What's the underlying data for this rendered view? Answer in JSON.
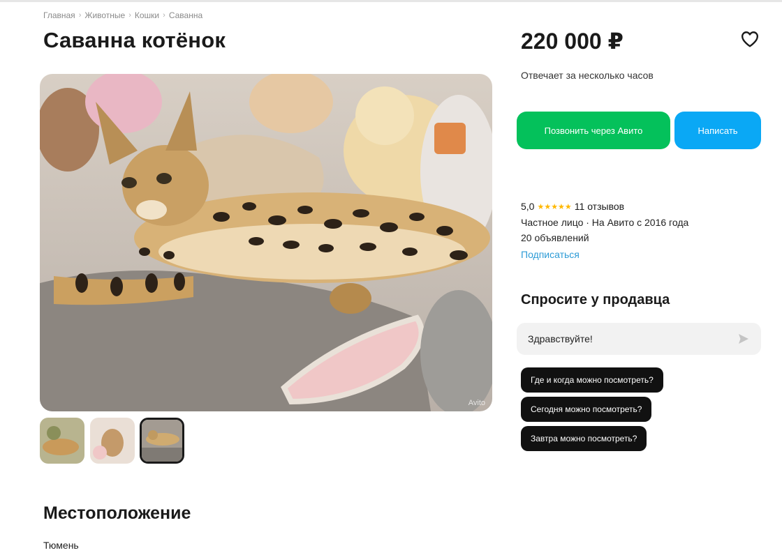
{
  "breadcrumb": [
    "Главная",
    "Животные",
    "Кошки",
    "Саванна"
  ],
  "listing": {
    "title": "Саванна котёнок",
    "price": "220 000 ₽"
  },
  "seller": {
    "reply_time": "Отвечает за несколько часов",
    "rating": "5,0",
    "stars": "★★★★★",
    "reviews": "11 отзывов",
    "type": "Частное лицо · На Авито с 2016 года",
    "ads_count": "20 объявлений",
    "subscribe_label": "Подписаться"
  },
  "actions": {
    "call_label": "Позвонить через Авито",
    "write_label": "Написать"
  },
  "ask": {
    "title": "Спросите у продавца",
    "message_value": "Здравствуйте!",
    "quick_questions": [
      "Где и когда можно посмотреть?",
      "Сегодня можно посмотреть?",
      "Завтра можно посмотреть?"
    ]
  },
  "photo": {
    "watermark": "Avito",
    "thumbnail_count": 3,
    "selected_thumbnail": 3
  },
  "location": {
    "title": "Местоположение",
    "city": "Тюмень"
  },
  "colors": {
    "call_button": "#04c15b",
    "write_button": "#0aa8f5",
    "link": "#2d9bd6",
    "stars": "#ffb800",
    "chip": "#111111"
  },
  "icons": [
    "heart-icon",
    "send-icon",
    "star-icon"
  ]
}
